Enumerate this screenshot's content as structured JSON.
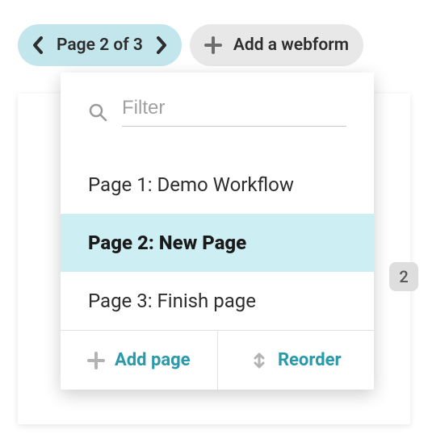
{
  "toolbar": {
    "page_position_label": "Page 2 of 3",
    "add_webform_label": "Add a webform"
  },
  "dropdown": {
    "filter_placeholder": "Filter",
    "pages": [
      {
        "label": "Page 1: Demo Workflow",
        "selected": false
      },
      {
        "label": "Page 2: New Page",
        "selected": true
      },
      {
        "label": "Page 3: Finish page",
        "selected": false
      }
    ],
    "add_page_label": "Add page",
    "reorder_label": "Reorder"
  },
  "side_badge": "2",
  "colors": {
    "accent": "#289aa9",
    "pill_blue": "#c3e6ec",
    "pill_gray": "#e8e8e8",
    "selected_bg": "#cdeef2"
  }
}
